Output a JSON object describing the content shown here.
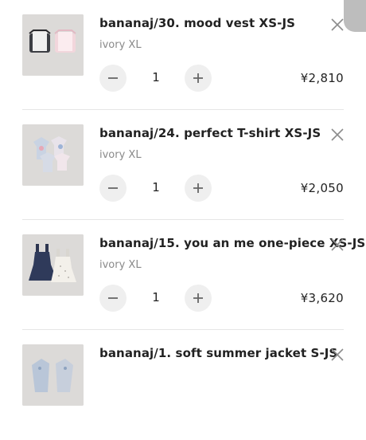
{
  "cart": {
    "items": [
      {
        "title": "bananaj/30. mood vest XS-JS",
        "variant": "ivory XL",
        "quantity": "1",
        "price": "¥2,810",
        "thumbnail_icon": "mood-vest-photo"
      },
      {
        "title": "bananaj/24. perfect T-shirt XS-JS",
        "variant": "ivory XL",
        "quantity": "1",
        "price": "¥2,050",
        "thumbnail_icon": "tshirt-photo"
      },
      {
        "title": "bananaj/15. you an me one-piece XS-JS",
        "variant": "ivory XL",
        "quantity": "1",
        "price": "¥3,620",
        "thumbnail_icon": "one-piece-photo"
      },
      {
        "title": "bananaj/1. soft summer jacket S-JS",
        "thumbnail_icon": "jacket-photo"
      }
    ]
  },
  "icons": {
    "remove": "close-icon",
    "decrease": "minus-icon",
    "increase": "plus-icon"
  },
  "colors": {
    "title": "#222222",
    "variant": "#8a8a8a",
    "stepper_bg": "#efefef",
    "divider": "#e6e6e6",
    "thumbnail_bg": "#dcdad8"
  }
}
